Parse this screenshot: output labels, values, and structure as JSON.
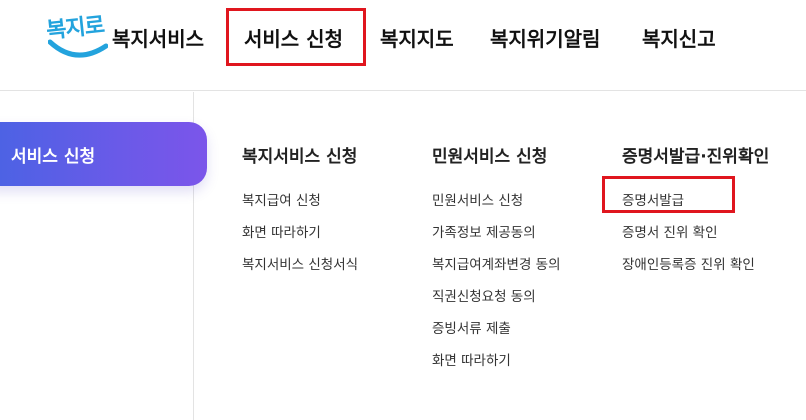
{
  "logo": {
    "text": "복지로",
    "icon": "bokjiro-logo"
  },
  "gnb": {
    "items": [
      {
        "label": "복지서비스"
      },
      {
        "label": "서비스 신청"
      },
      {
        "label": "복지지도"
      },
      {
        "label": "복지위기알림"
      },
      {
        "label": "복지신고"
      }
    ]
  },
  "side": {
    "active_label": "서비스 신청"
  },
  "submenu": {
    "columns": [
      {
        "title": "복지서비스 신청",
        "items": [
          "복지급여 신청",
          "화면 따라하기",
          "복지서비스 신청서식"
        ]
      },
      {
        "title": "민원서비스 신청",
        "items": [
          "민원서비스 신청",
          "가족정보 제공동의",
          "복지급여계좌변경 동의",
          "직권신청요청 동의",
          "증빙서류 제출",
          "화면 따라하기"
        ]
      },
      {
        "title": "증명서발급·진위확인",
        "items": [
          "증명서발급",
          "증명서 진위 확인",
          "장애인등록증 진위 확인"
        ]
      }
    ]
  },
  "colors": {
    "highlight": "#e0161e",
    "accent_start": "#4a63e4",
    "accent_end": "#7b55ea",
    "logo_blue": "#23a3dd"
  }
}
